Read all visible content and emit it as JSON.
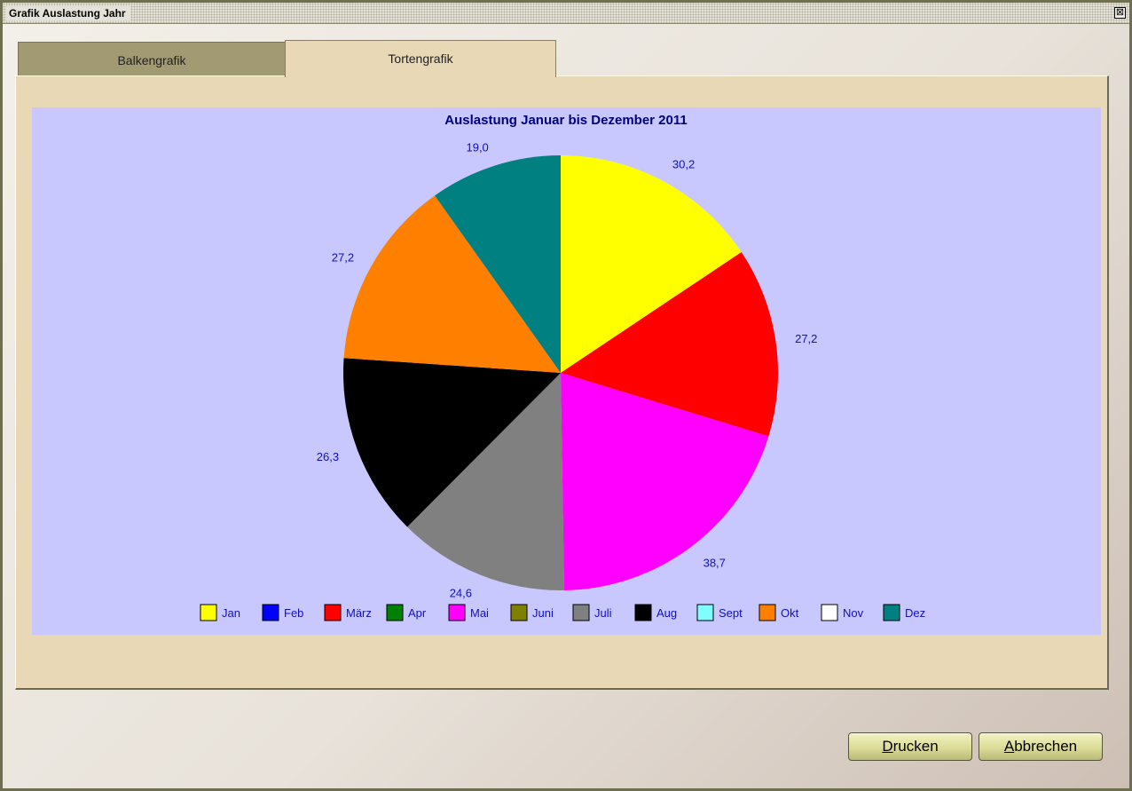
{
  "window": {
    "title": "Grafik Auslastung Jahr",
    "close_glyph": "⊠"
  },
  "tabs": [
    {
      "label": "Balkengrafik",
      "active": false
    },
    {
      "label": "Tortengrafik",
      "active": true
    }
  ],
  "buttons": {
    "print": {
      "mnemonic": "D",
      "rest": "rucken"
    },
    "cancel": {
      "mnemonic": "A",
      "rest": "bbrechen"
    }
  },
  "chart_data": {
    "type": "pie",
    "title": "Auslastung  Januar bis Dezember  2011",
    "background": "#c8c8ff",
    "label_color": "#1010c0",
    "legend_position": "bottom",
    "slices": [
      {
        "name": "Jan",
        "value": 30.2,
        "label": "30,2",
        "color": "#ffff00"
      },
      {
        "name": "Feb",
        "value": 0,
        "label": "",
        "color": "#0000ff"
      },
      {
        "name": "März",
        "value": 27.2,
        "label": "27,2",
        "color": "#ff0000"
      },
      {
        "name": "Apr",
        "value": 0,
        "label": "",
        "color": "#008000"
      },
      {
        "name": "Mai",
        "value": 38.7,
        "label": "38,7",
        "color": "#ff00ff"
      },
      {
        "name": "Juni",
        "value": 0,
        "label": "",
        "color": "#808000"
      },
      {
        "name": "Juli",
        "value": 24.6,
        "label": "24,6",
        "color": "#808080"
      },
      {
        "name": "Aug",
        "value": 26.3,
        "label": "26,3",
        "color": "#000000"
      },
      {
        "name": "Sept",
        "value": 0,
        "label": "",
        "color": "#80ffff"
      },
      {
        "name": "Okt",
        "value": 27.2,
        "label": "27,2",
        "color": "#ff8000"
      },
      {
        "name": "Nov",
        "value": 0,
        "label": "",
        "color": "#ffffff"
      },
      {
        "name": "Dez",
        "value": 19.0,
        "label": "19,0",
        "color": "#008080"
      }
    ]
  }
}
